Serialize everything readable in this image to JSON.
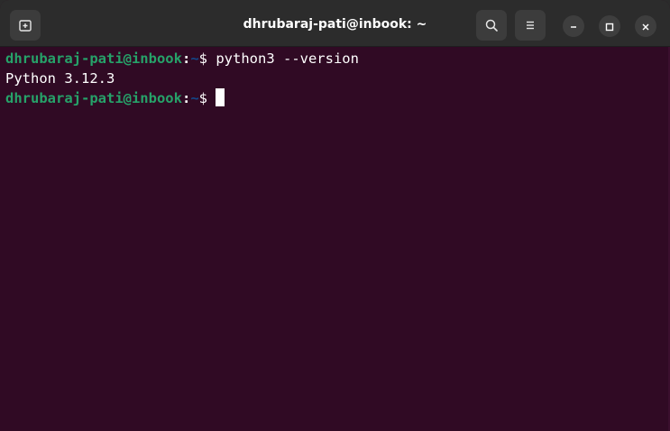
{
  "window": {
    "title": "dhrubaraj-pati@inbook: ~"
  },
  "titlebar": {
    "new_tab_icon": "new-tab-icon",
    "search_icon": "search-icon",
    "menu_icon": "hamburger-menu-icon",
    "minimize_icon": "minimize-icon",
    "maximize_icon": "maximize-icon",
    "close_icon": "close-icon"
  },
  "terminal": {
    "colors": {
      "background": "#300a24",
      "user_host": "#26a269",
      "path": "#12488b",
      "text": "#ffffff"
    },
    "lines": [
      {
        "prompt_user": "dhrubaraj-pati@inbook",
        "prompt_colon": ":",
        "prompt_path": "~",
        "prompt_symbol": "$ ",
        "command": "python3 --version"
      },
      {
        "output": "Python 3.12.3"
      },
      {
        "prompt_user": "dhrubaraj-pati@inbook",
        "prompt_colon": ":",
        "prompt_path": "~",
        "prompt_symbol": "$ ",
        "command": ""
      }
    ]
  }
}
